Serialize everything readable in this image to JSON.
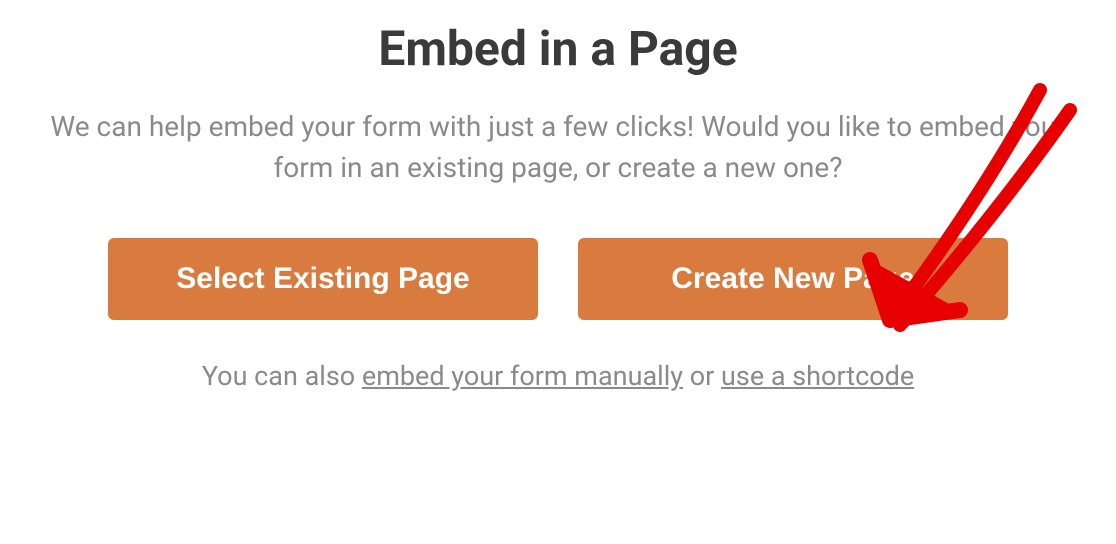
{
  "title": "Embed in a Page",
  "description": "We can help embed your form with just a few clicks! Would you like to embed your form in an existing page, or create a new one?",
  "buttons": {
    "select_existing": "Select Existing Page",
    "create_new": "Create New Page"
  },
  "footer": {
    "prefix": "You can also ",
    "link_manual": "embed your form manually",
    "middle": " or ",
    "link_shortcode": "use a shortcode"
  },
  "annotation": {
    "color": "#e60000",
    "target": "create-new-page-button"
  }
}
